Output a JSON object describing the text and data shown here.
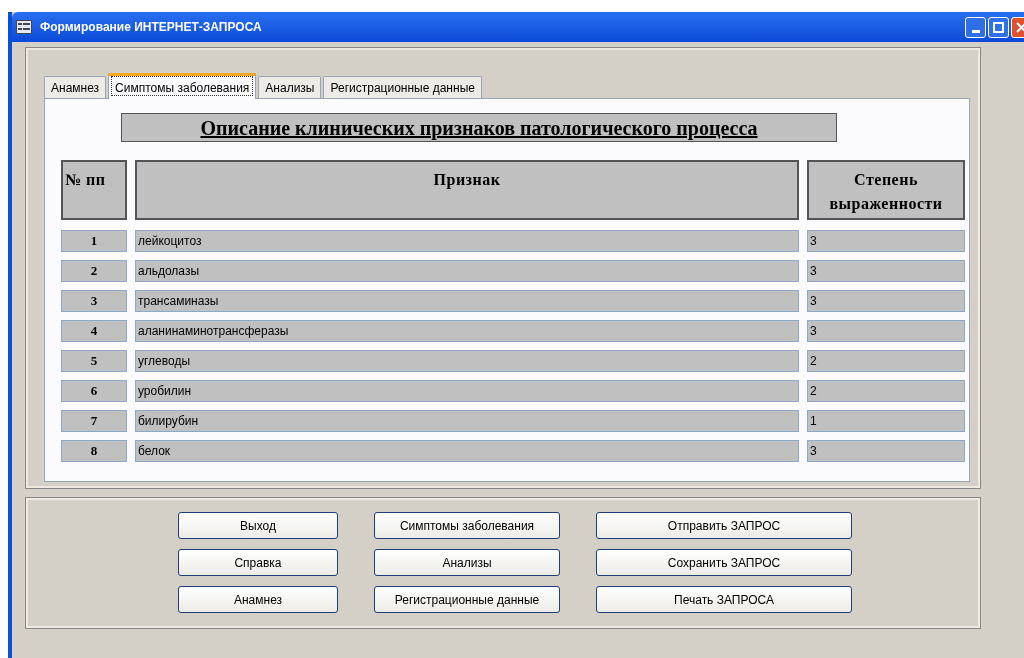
{
  "window": {
    "title": "Формирование ИНТЕРНЕТ-ЗАПРОСА"
  },
  "tabs": [
    {
      "label": "Анамнез",
      "selected": false
    },
    {
      "label": "Симптомы заболевания",
      "selected": true
    },
    {
      "label": "Анализы",
      "selected": false
    },
    {
      "label": "Регистрационные данные",
      "selected": false
    }
  ],
  "panel": {
    "heading": "Описание клинических признаков патологического процесса"
  },
  "table": {
    "columns": [
      "№ пп",
      "Признак",
      "Степень выраженности"
    ],
    "rows": [
      {
        "number": "1",
        "feature": "лейкоцитоз",
        "degree": "3"
      },
      {
        "number": "2",
        "feature": "альдолазы",
        "degree": "3"
      },
      {
        "number": "3",
        "feature": "трансаминазы",
        "degree": "3"
      },
      {
        "number": "4",
        "feature": "аланинаминотрансферазы",
        "degree": "3"
      },
      {
        "number": "5",
        "feature": "углеводы",
        "degree": "2"
      },
      {
        "number": "6",
        "feature": "уробилин",
        "degree": "2"
      },
      {
        "number": "7",
        "feature": "билирубин",
        "degree": "1"
      },
      {
        "number": "8",
        "feature": "белок",
        "degree": "3"
      }
    ]
  },
  "buttons": [
    "Выход",
    "Симптомы заболевания",
    "Отправить ЗАПРОС",
    "Справка",
    "Анализы",
    "Сохранить ЗАПРОС",
    "Анамнез",
    "Регистрационные данные",
    "Печать ЗАПРОСА"
  ]
}
